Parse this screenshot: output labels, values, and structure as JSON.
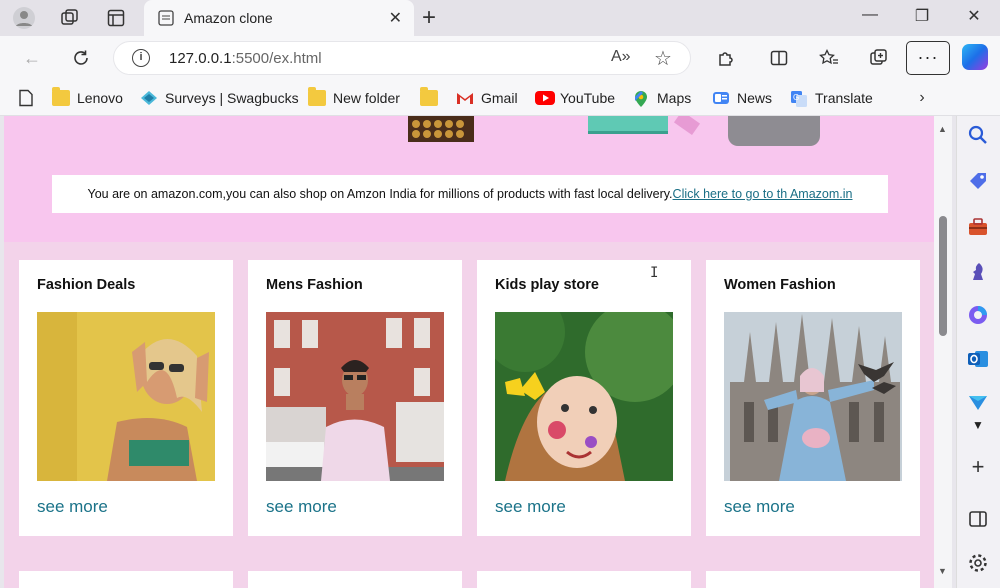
{
  "browser": {
    "tab_title": "Amazon clone",
    "tab_close": "✕",
    "newtab": "+",
    "url_host": "127.0.0.1",
    "url_path": ":5500/ex.html",
    "read_aloud": "A»",
    "favorite": "☆",
    "more": "···",
    "win_min": "—",
    "win_max": "❐",
    "win_close": "✕"
  },
  "bookmarks": [
    {
      "label": "Lenovo",
      "icon": "folder-icon"
    },
    {
      "label": "Surveys | Swagbucks",
      "icon": "swagbucks-icon"
    },
    {
      "label": "New folder",
      "icon": "folder-icon"
    },
    {
      "label": "",
      "icon": "folder-icon"
    },
    {
      "label": "Gmail",
      "icon": "gmail-icon"
    },
    {
      "label": "YouTube",
      "icon": "youtube-icon"
    },
    {
      "label": "Maps",
      "icon": "maps-icon"
    },
    {
      "label": "News",
      "icon": "news-icon"
    },
    {
      "label": "Translate",
      "icon": "translate-icon"
    }
  ],
  "page": {
    "notice_text": "You are on amazon.com,you can also shop on Amzon India for millions of products with fast local delivery.",
    "notice_link": "Click here to go to th Amazom.in",
    "cards": [
      {
        "title": "Fashion Deals",
        "more": "see more",
        "image": "woman-sunglasses-yellow-wall"
      },
      {
        "title": "Mens Fashion",
        "more": "see more",
        "image": "man-street-pink-shirt"
      },
      {
        "title": "Kids play store",
        "more": "see more",
        "image": "child-painted-face"
      },
      {
        "title": "Women Fashion",
        "more": "see more",
        "image": "woman-cathedral-birds"
      }
    ]
  },
  "colors": {
    "page_bg": "#f5d2ee",
    "link": "#1b7389",
    "hero_bg": "#f8c6ee"
  }
}
